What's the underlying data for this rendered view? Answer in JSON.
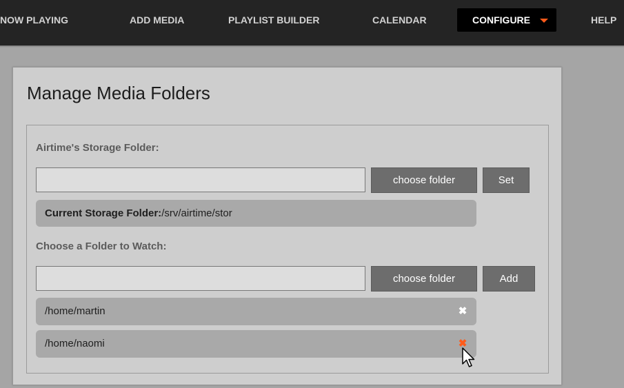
{
  "nav": {
    "items": [
      {
        "label": "NOW PLAYING"
      },
      {
        "label": "ADD MEDIA"
      },
      {
        "label": "PLAYLIST BUILDER"
      },
      {
        "label": "CALENDAR"
      },
      {
        "label": "CONFIGURE",
        "active": true
      },
      {
        "label": "HELP"
      }
    ]
  },
  "panel": {
    "title": "Manage Media Folders",
    "storage": {
      "label": "Airtime's Storage Folder:",
      "input_value": "",
      "choose_button": "choose folder",
      "set_button": "Set",
      "current_label": "Current Storage Folder:",
      "current_path": "/srv/airtime/stor"
    },
    "watch": {
      "label": "Choose a Folder to Watch:",
      "input_value": "",
      "choose_button": "choose folder",
      "add_button": "Add",
      "folders": [
        {
          "path": "/home/martin",
          "remove": "✖"
        },
        {
          "path": "/home/naomi",
          "remove": "✖"
        }
      ]
    }
  },
  "colors": {
    "accent": "#ff5b1a",
    "topbar": "#242424",
    "button": "#6d6d6d"
  }
}
